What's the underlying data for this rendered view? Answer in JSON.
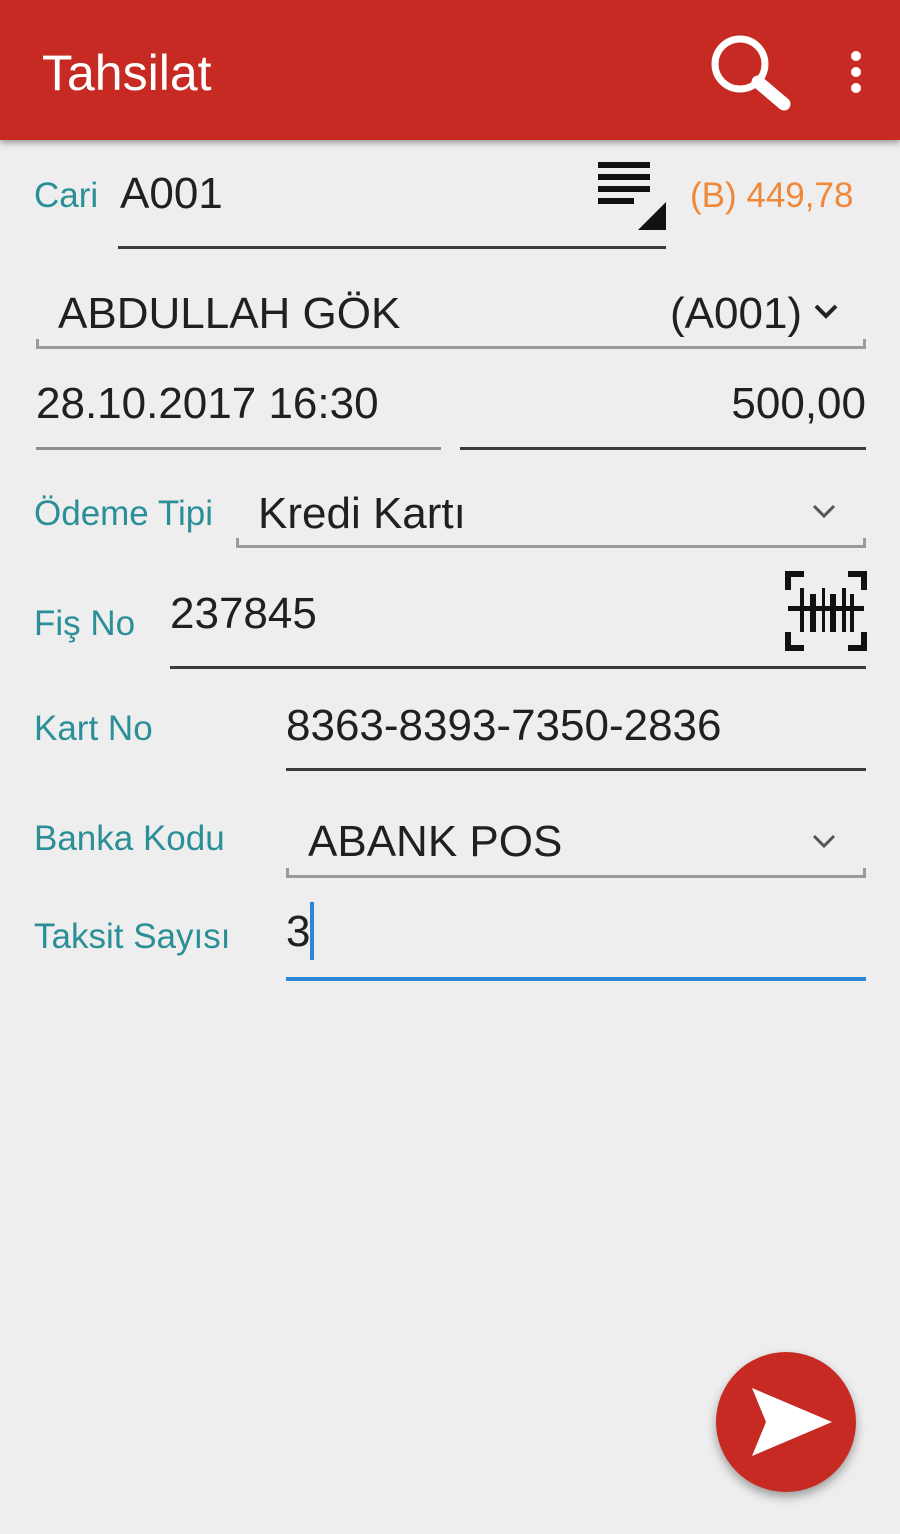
{
  "appbar": {
    "title": "Tahsilat",
    "color": "#c62a22",
    "search_icon": "search-icon",
    "menu_icon": "more-vert-icon"
  },
  "form": {
    "cari": {
      "label": "Cari",
      "value": "A001",
      "list_icon": "list-select-icon",
      "balance": "(B) 449,78"
    },
    "customer": {
      "name": "ABDULLAH GÖK",
      "code": "(A001)"
    },
    "datetime": "28.10.2017 16:30",
    "amount": "500,00",
    "odeme_tipi": {
      "label": "Ödeme Tipi",
      "value": "Kredi Kartı"
    },
    "fis_no": {
      "label": "Fiş No",
      "value": "237845",
      "scan_icon": "barcode-scan-icon"
    },
    "kart_no": {
      "label": "Kart No",
      "value": "8363-8393-7350-2836"
    },
    "banka_kodu": {
      "label": "Banka Kodu",
      "value": "ABANK POS"
    },
    "taksit_sayisi": {
      "label": "Taksit Sayısı",
      "value": "3"
    }
  },
  "fab": {
    "icon": "send-icon"
  },
  "colors": {
    "label": "#2a8f97",
    "balance": "#f0883a",
    "focus_underline": "#2b87d6",
    "background": "#eeeeee"
  }
}
